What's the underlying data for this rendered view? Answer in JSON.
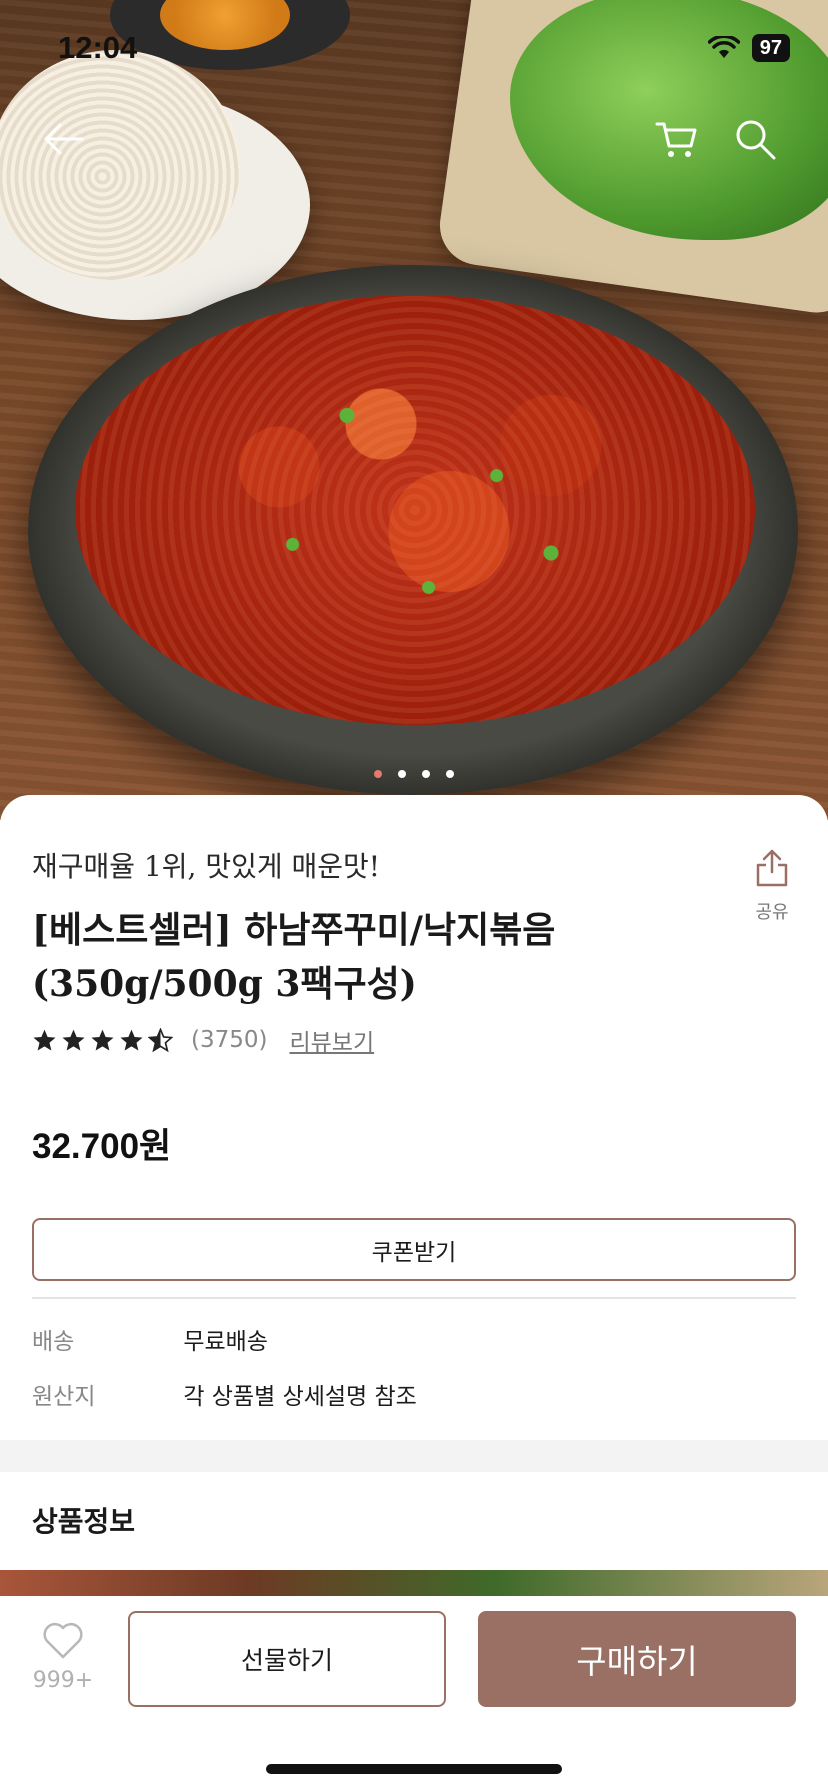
{
  "status_bar": {
    "time": "12:04",
    "battery": "97"
  },
  "nav": {
    "back_icon": "back-arrow-icon",
    "cart_icon": "cart-icon",
    "search_icon": "search-icon"
  },
  "carousel": {
    "total": 4,
    "active_index": 0
  },
  "product": {
    "subtitle": "재구매율 1위, 맛있게 매운맛!",
    "title": "[베스트셀러] 하남쭈꾸미/낙지볶음 (350g/500g 3팩구성)",
    "share_label": "공유",
    "rating_stars": 4.5,
    "review_count": "(3750)",
    "review_link": "리뷰보기",
    "price": "32.700원"
  },
  "coupon_button": "쿠폰받기",
  "info_rows": [
    {
      "label": "배송",
      "value": "무료배송"
    },
    {
      "label": "원산지",
      "value": "각 상품별 상세설명 참조"
    }
  ],
  "section_title": "상품정보",
  "bottom_bar": {
    "wish_count": "999+",
    "gift_button": "선물하기",
    "buy_button": "구매하기"
  },
  "colors": {
    "accent": "#9a7065",
    "active_dot": "#e27a6e"
  }
}
